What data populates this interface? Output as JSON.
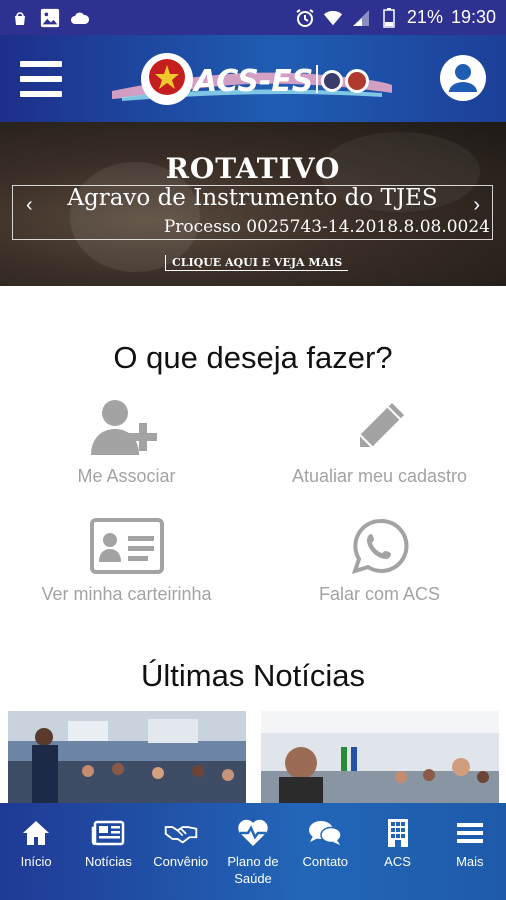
{
  "status_bar": {
    "battery": "21%",
    "time": "19:30"
  },
  "header": {
    "logo_text": "ACS-ES"
  },
  "banner": {
    "title": "ROTATIVO",
    "subtitle": "Agravo de Instrumento do TJES",
    "process": "Processo 0025743-14.2018.8.08.0024",
    "cta": "CLIQUE AQUI E VEJA MAIS"
  },
  "actions_section": {
    "title": "O que deseja fazer?",
    "items": [
      {
        "label": "Me Associar",
        "icon": "add-user-icon"
      },
      {
        "label": "Atualiar meu cadastro",
        "icon": "pencil-icon"
      },
      {
        "label": "Ver minha carteirinha",
        "icon": "id-card-icon"
      },
      {
        "label": "Falar com ACS",
        "icon": "whatsapp-icon"
      }
    ]
  },
  "news_section": {
    "title": "Últimas Notícias"
  },
  "bottom_nav": {
    "items": [
      {
        "label": "Início",
        "icon": "home-icon"
      },
      {
        "label": "Notícias",
        "icon": "newspaper-icon"
      },
      {
        "label": "Convênio",
        "icon": "handshake-icon"
      },
      {
        "label": "Plano de Saúde",
        "icon": "heart-pulse-icon"
      },
      {
        "label": "Contato",
        "icon": "chat-icon"
      },
      {
        "label": "ACS",
        "icon": "building-icon"
      },
      {
        "label": "Mais",
        "icon": "menu-icon"
      }
    ]
  },
  "colors": {
    "status_bar": "#2e3190",
    "header_blue": "#1f5db3",
    "action_gray": "#a3a3a3"
  }
}
